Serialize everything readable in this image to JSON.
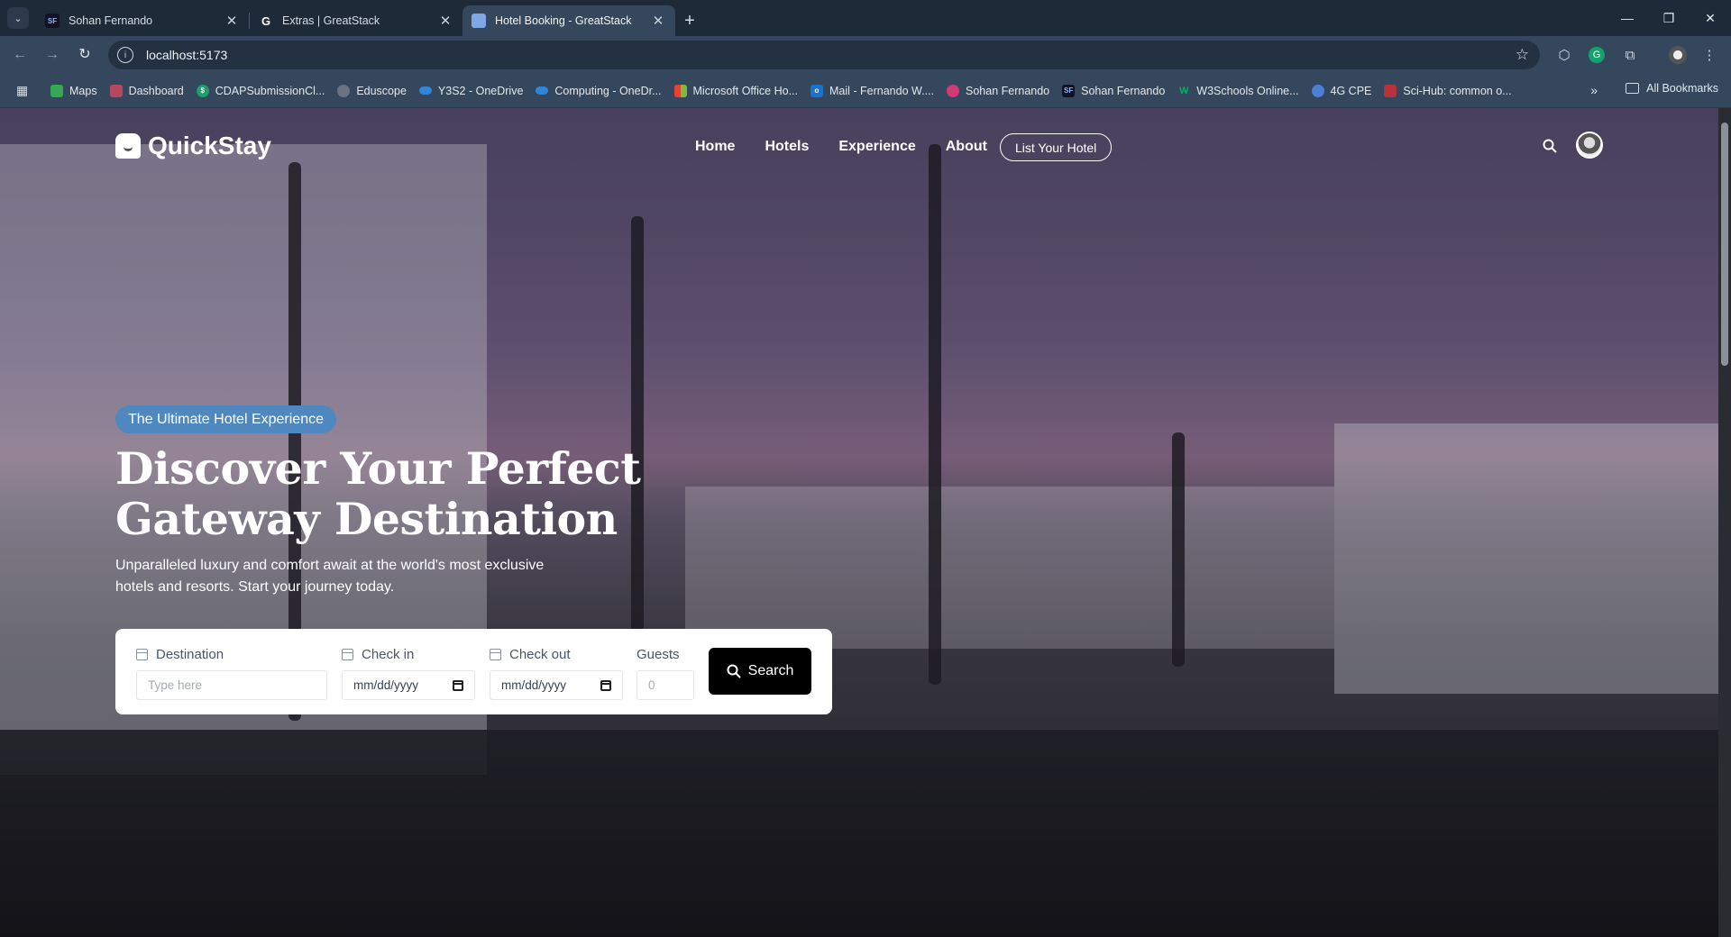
{
  "browser": {
    "tabs": [
      {
        "title": "Sohan Fernando",
        "favicon": "SF"
      },
      {
        "title": "Extras | GreatStack",
        "favicon": "G"
      },
      {
        "title": "Hotel Booking - GreatStack",
        "favicon": "H"
      }
    ],
    "active_tab": 2,
    "url": "localhost:5173",
    "bookmarks": [
      {
        "label": "Maps",
        "icon": "maps-icon",
        "color": "#34a853"
      },
      {
        "label": "Dashboard",
        "icon": "dashboard-icon",
        "color": "#b5485f"
      },
      {
        "label": "CDAPSubmissionCl...",
        "icon": "dollar-icon",
        "color": "#1f9d6a"
      },
      {
        "label": "Eduscope",
        "icon": "eduscope-icon",
        "color": "#6b7280"
      },
      {
        "label": "Y3S2 - OneDrive",
        "icon": "cloud-icon",
        "color": "#2f86d6"
      },
      {
        "label": "Computing - OneDr...",
        "icon": "cloud-icon",
        "color": "#2f86d6"
      },
      {
        "label": "Microsoft Office Ho...",
        "icon": "office-icon",
        "color": "#e8412f"
      },
      {
        "label": "Mail - Fernando W....",
        "icon": "mail-icon",
        "color": "#1a73c8"
      },
      {
        "label": "Sohan Fernando",
        "icon": "spiral-icon",
        "color": "#d23a76"
      },
      {
        "label": "Sohan Fernando",
        "icon": "sf-icon",
        "color": "#101321"
      },
      {
        "label": "W3Schools Online...",
        "icon": "w3-icon",
        "color": "#04aa6d"
      },
      {
        "label": "4G CPE",
        "icon": "router-icon",
        "color": "#4d7fd6"
      },
      {
        "label": "Sci-Hub: common o...",
        "icon": "scihub-icon",
        "color": "#b8323b"
      }
    ],
    "all_bookmarks_label": "All Bookmarks"
  },
  "site": {
    "logo": "QuickStay",
    "nav": [
      "Home",
      "Hotels",
      "Experience",
      "About"
    ],
    "list_hotel_label": "List Your Hotel",
    "badge": "The Ultimate Hotel Experience",
    "headline": "Discover Your Perfect Gateway Destination",
    "subline": "Unparalleled luxury and comfort await at the world's most exclusive hotels and resorts. Start your journey today.",
    "booking": {
      "destination_label": "Destination",
      "destination_placeholder": "Type here",
      "checkin_label": "Check in",
      "checkin_placeholder": "mm/dd/yyyy",
      "checkout_label": "Check out",
      "checkout_placeholder": "mm/dd/yyyy",
      "guests_label": "Guests",
      "guests_placeholder": "0",
      "search_label": "Search"
    }
  }
}
